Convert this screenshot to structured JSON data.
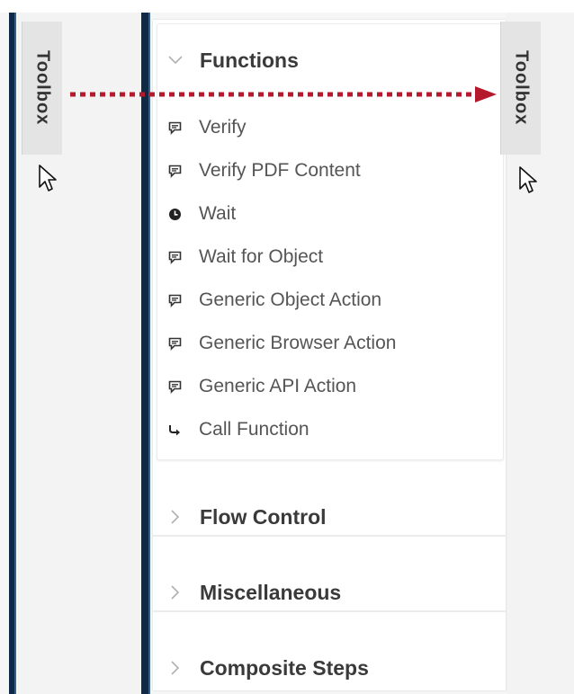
{
  "toolbox_left": {
    "label": "Toolbox"
  },
  "toolbox_right": {
    "label": "Toolbox"
  },
  "sections": {
    "functions": {
      "title": "Functions",
      "expanded": true
    },
    "flow_control": {
      "title": "Flow Control",
      "expanded": false
    },
    "miscellaneous": {
      "title": "Miscellaneous",
      "expanded": false
    },
    "composite_steps": {
      "title": "Composite Steps",
      "expanded": false
    }
  },
  "function_items": [
    {
      "label": "Verify",
      "icon": "comment-icon"
    },
    {
      "label": "Verify PDF Content",
      "icon": "comment-icon"
    },
    {
      "label": "Wait",
      "icon": "clock-icon"
    },
    {
      "label": "Wait for Object",
      "icon": "comment-icon"
    },
    {
      "label": "Generic Object Action",
      "icon": "comment-icon"
    },
    {
      "label": "Generic Browser Action",
      "icon": "comment-icon"
    },
    {
      "label": "Generic API Action",
      "icon": "comment-icon"
    },
    {
      "label": "Call Function",
      "icon": "share-arrow-icon"
    }
  ],
  "colors": {
    "accent_bar": "#0e2a47",
    "arrow": "#b5192c",
    "text": "#555555",
    "header_text": "#3a3a3a"
  }
}
